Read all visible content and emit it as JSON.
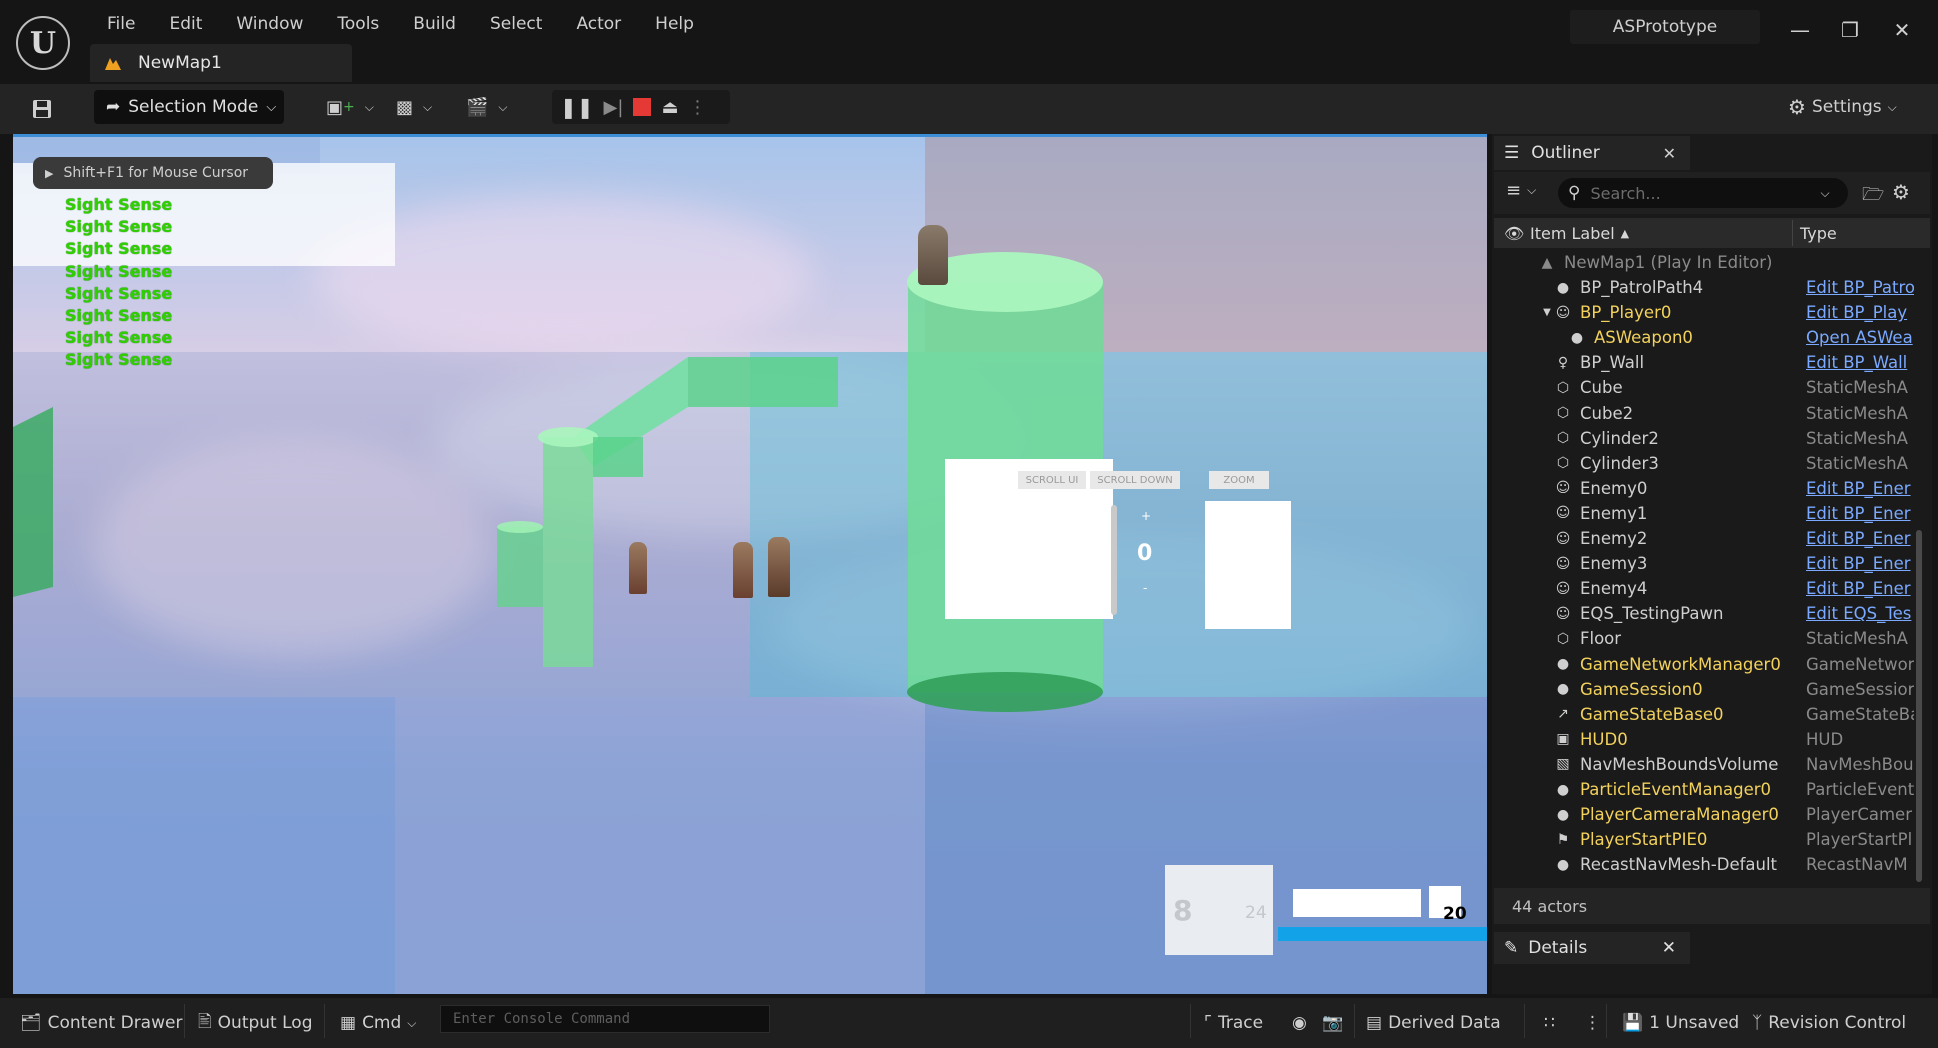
{
  "window": {
    "project_name": "ASPrototype",
    "document_tab": "NewMap1",
    "menu": [
      "File",
      "Edit",
      "Window",
      "Tools",
      "Build",
      "Select",
      "Actor",
      "Help"
    ]
  },
  "toolbar": {
    "mode_label": "Selection Mode",
    "settings_label": "Settings"
  },
  "viewport": {
    "hint": "Shift+F1 for Mouse Cursor",
    "debug_lines": [
      "Sight Sense",
      "Sight Sense",
      "Sight Sense",
      "Sight Sense",
      "Sight Sense",
      "Sight Sense",
      "Sight Sense",
      "Sight Sense"
    ],
    "hud": {
      "scroll_up": "SCROLL UI",
      "scroll_down": "SCROLL DOWN",
      "zoom": "ZOOM",
      "plus": "+",
      "minus": "-",
      "zoom_value": "0",
      "ammo": "8",
      "ammo_reserve": "24",
      "health_value": "20"
    }
  },
  "outliner": {
    "tab_label": "Outliner",
    "search_placeholder": "Search...",
    "col_label": "Item Label",
    "col_type": "Type",
    "root": "NewMap1 (Play In Editor)",
    "rows": [
      {
        "label": "BP_PatrolPath4",
        "type": "Edit BP_Patro",
        "link": true,
        "icon": "actor",
        "indent": 1,
        "color": "#cfcfcf"
      },
      {
        "label": "BP_Player0",
        "type": "Edit BP_Play",
        "link": true,
        "icon": "pawn",
        "indent": 1,
        "color": "#f2d15c",
        "expanded": true
      },
      {
        "label": "ASWeapon0",
        "type": "Open ASWea",
        "link": true,
        "icon": "actor",
        "indent": 2,
        "color": "#f2d15c"
      },
      {
        "label": "BP_Wall",
        "type": "Edit BP_Wall",
        "link": true,
        "icon": "person",
        "indent": 1,
        "color": "#cfcfcf"
      },
      {
        "label": "Cube",
        "type": "StaticMeshA",
        "link": false,
        "icon": "mesh",
        "indent": 1,
        "color": "#cfcfcf"
      },
      {
        "label": "Cube2",
        "type": "StaticMeshA",
        "link": false,
        "icon": "mesh",
        "indent": 1,
        "color": "#cfcfcf"
      },
      {
        "label": "Cylinder2",
        "type": "StaticMeshA",
        "link": false,
        "icon": "mesh",
        "indent": 1,
        "color": "#cfcfcf"
      },
      {
        "label": "Cylinder3",
        "type": "StaticMeshA",
        "link": false,
        "icon": "mesh",
        "indent": 1,
        "color": "#cfcfcf"
      },
      {
        "label": "Enemy0",
        "type": "Edit BP_Ener",
        "link": true,
        "icon": "pawn",
        "indent": 1,
        "color": "#cfcfcf"
      },
      {
        "label": "Enemy1",
        "type": "Edit BP_Ener",
        "link": true,
        "icon": "pawn",
        "indent": 1,
        "color": "#cfcfcf"
      },
      {
        "label": "Enemy2",
        "type": "Edit BP_Ener",
        "link": true,
        "icon": "pawn",
        "indent": 1,
        "color": "#cfcfcf"
      },
      {
        "label": "Enemy3",
        "type": "Edit BP_Ener",
        "link": true,
        "icon": "pawn",
        "indent": 1,
        "color": "#cfcfcf"
      },
      {
        "label": "Enemy4",
        "type": "Edit BP_Ener",
        "link": true,
        "icon": "pawn",
        "indent": 1,
        "color": "#cfcfcf"
      },
      {
        "label": "EQS_TestingPawn",
        "type": "Edit EQS_Tes",
        "link": true,
        "icon": "pawn",
        "indent": 1,
        "color": "#cfcfcf"
      },
      {
        "label": "Floor",
        "type": "StaticMeshA",
        "link": false,
        "icon": "mesh",
        "indent": 1,
        "color": "#cfcfcf"
      },
      {
        "label": "GameNetworkManager0",
        "type": "GameNetwor",
        "link": false,
        "icon": "actor",
        "indent": 1,
        "color": "#f2d15c"
      },
      {
        "label": "GameSession0",
        "type": "GameSessior",
        "link": false,
        "icon": "actor",
        "indent": 1,
        "color": "#f2d15c"
      },
      {
        "label": "GameStateBase0",
        "type": "GameStateBa",
        "link": false,
        "icon": "graph",
        "indent": 1,
        "color": "#f2d15c"
      },
      {
        "label": "HUD0",
        "type": "HUD",
        "link": false,
        "icon": "hud",
        "indent": 1,
        "color": "#f2d15c"
      },
      {
        "label": "NavMeshBoundsVolume",
        "type": "NavMeshBou",
        "link": false,
        "icon": "volume",
        "indent": 1,
        "color": "#cfcfcf"
      },
      {
        "label": "ParticleEventManager0",
        "type": "ParticleEvent",
        "link": false,
        "icon": "actor",
        "indent": 1,
        "color": "#f2d15c"
      },
      {
        "label": "PlayerCameraManager0",
        "type": "PlayerCamer",
        "link": false,
        "icon": "actor",
        "indent": 1,
        "color": "#f2d15c"
      },
      {
        "label": "PlayerStartPIE0",
        "type": "PlayerStartPl",
        "link": false,
        "icon": "flag",
        "indent": 1,
        "color": "#f2d15c"
      },
      {
        "label": "RecastNavMesh-Default",
        "type": "RecastNavM",
        "link": false,
        "icon": "actor",
        "indent": 1,
        "color": "#cfcfcf"
      }
    ],
    "actor_count": "44 actors"
  },
  "details": {
    "tab_label": "Details"
  },
  "statusbar": {
    "content_drawer": "Content Drawer",
    "output_log": "Output Log",
    "cmd": "Cmd",
    "console_placeholder": "Enter Console Command",
    "trace": "Trace",
    "derived_data": "Derived Data",
    "unsaved": "1 Unsaved",
    "revision_control": "Revision Control"
  },
  "colors": {
    "accent": "#3c8fd6",
    "link": "#7aa9ff",
    "highlight_label": "#f2d15c",
    "sight_text": "#2fd000",
    "stop_button": "#e53935"
  }
}
